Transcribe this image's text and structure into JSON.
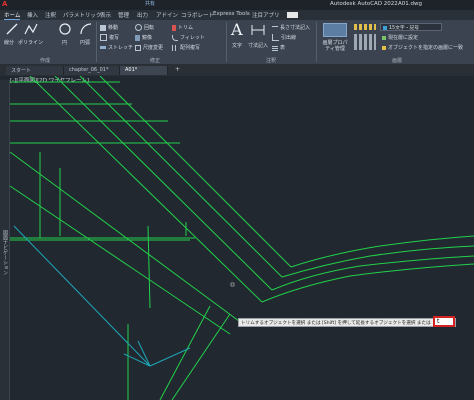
{
  "app": {
    "title": "Autodesk AutoCAD 2022",
    "file": "A01.dwg",
    "share_label": "共有"
  },
  "ribbon_tabs": [
    "ホーム",
    "挿入",
    "注釈",
    "パラメトリック",
    "表示",
    "管理",
    "出力",
    "アドイン",
    "コラボレート",
    "Express Tools",
    "注目アプリ"
  ],
  "ribbon": {
    "draw": {
      "group_label": "作成",
      "buttons": [
        "線分",
        "ポリライン",
        "円",
        "円弧"
      ]
    },
    "modify": {
      "group_label": "修正",
      "buttons": [
        "移動",
        "回転",
        "トリム",
        "複写",
        "鏡像",
        "フィレット",
        "ストレッチ",
        "尺度変更",
        "配列複写"
      ]
    },
    "annotation": {
      "group_label": "注釈",
      "buttons": [
        "文字",
        "寸法記入",
        "長さ寸法記入",
        "引出線",
        "表"
      ]
    },
    "layers": {
      "group_label": "画層",
      "buttons": [
        "画層プロパティ管理",
        "現在層に設定",
        "オブジェクトを指定の画層に一致"
      ],
      "current_layer": "15文字・記号"
    }
  },
  "doc_tabs": [
    "スタート",
    "chapter_06_01*",
    "A01*"
  ],
  "viewport_label": "[-][平面図][2D ワイヤフレーム]",
  "side_palette_label": "図面ナビゲーション",
  "command_line": {
    "prompt": "トリムするオブジェクトを選択 または [Shift] を押して延長するオブジェクトを選択 または",
    "input_value": "t"
  },
  "colors": {
    "drawing_lines": "#22d14a",
    "cyan_lines": "#1fa6b8",
    "highlight_box": "#d32222",
    "canvas_bg": "#212830"
  }
}
